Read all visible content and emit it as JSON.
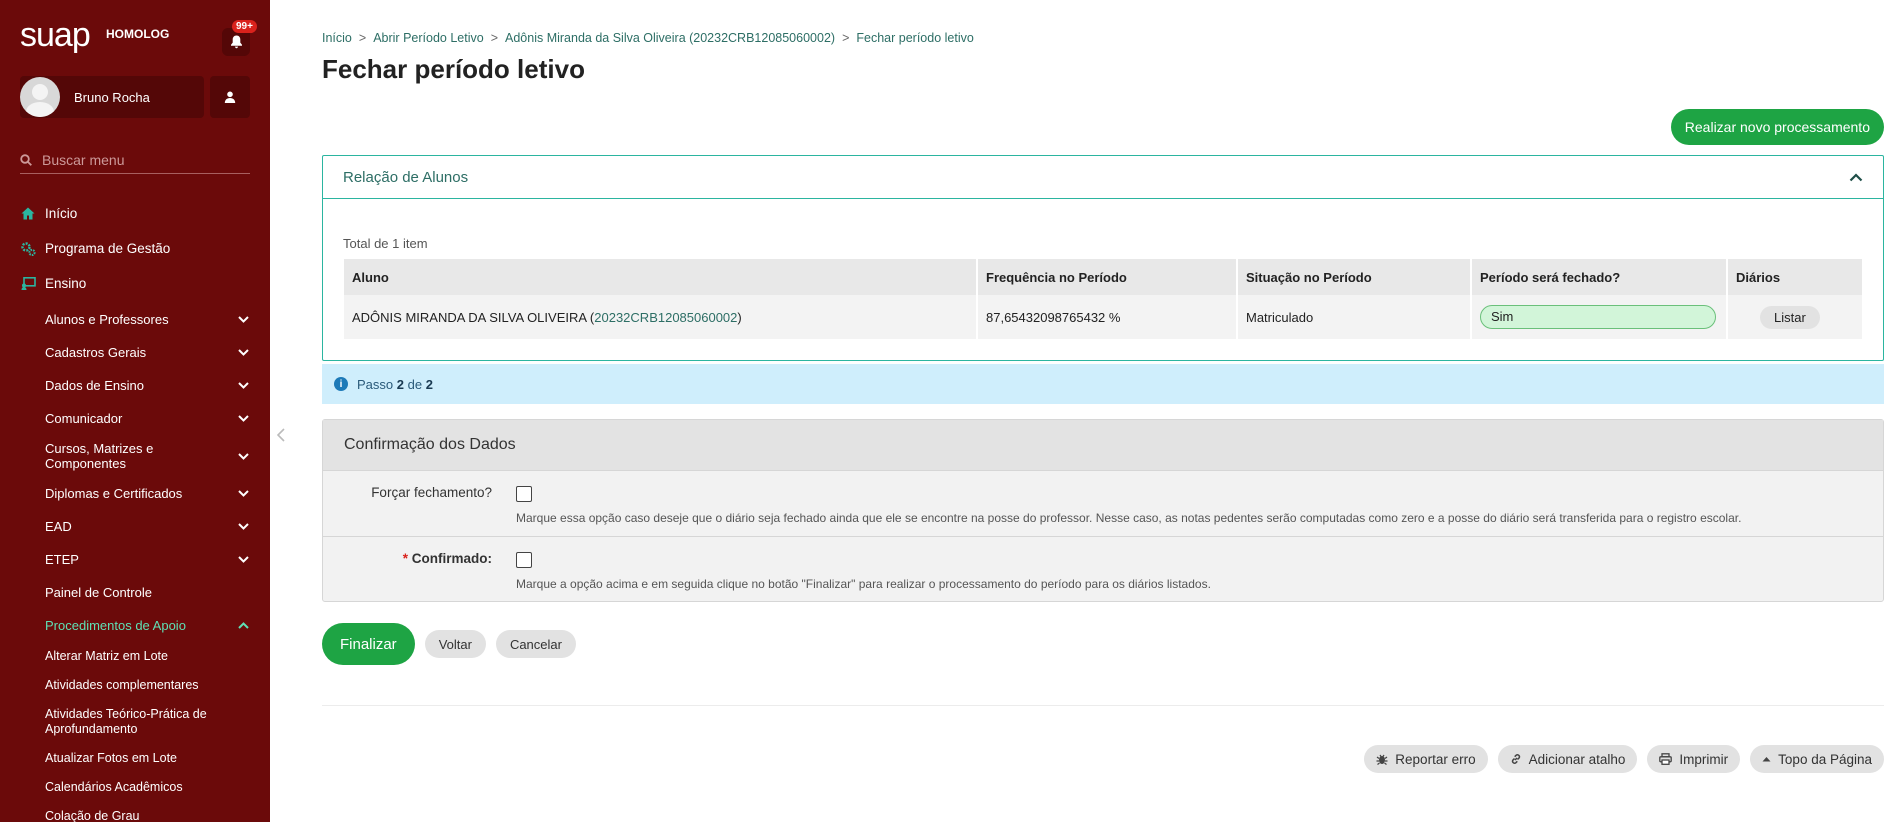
{
  "sidebar": {
    "logo": "suap",
    "environment": "HOMOLOG",
    "notifications_badge": "99+",
    "user_name": "Bruno Rocha",
    "search_placeholder": "Buscar menu",
    "top_items": [
      {
        "label": "Início",
        "icon": "home-icon"
      },
      {
        "label": "Programa de Gestão",
        "icon": "gears-icon"
      },
      {
        "label": "Ensino",
        "icon": "board-icon"
      }
    ],
    "ensino_items": [
      {
        "label": "Alunos e Professores",
        "expandable": true
      },
      {
        "label": "Cadastros Gerais",
        "expandable": true
      },
      {
        "label": "Dados de Ensino",
        "expandable": true
      },
      {
        "label": "Comunicador",
        "expandable": true
      },
      {
        "label": "Cursos, Matrizes e Componentes",
        "expandable": true
      },
      {
        "label": "Diplomas e Certificados",
        "expandable": true
      },
      {
        "label": "EAD",
        "expandable": true
      },
      {
        "label": "ETEP",
        "expandable": true
      },
      {
        "label": "Painel de Controle",
        "expandable": false
      },
      {
        "label": "Procedimentos de Apoio",
        "expandable": true,
        "active": true
      }
    ],
    "procedimentos_items": [
      "Alterar Matriz em Lote",
      "Atividades complementares",
      "Atividades Teórico-Prática de Aprofundamento",
      "Atualizar Fotos em Lote",
      "Calendários Acadêmicos",
      "Colação de Grau"
    ]
  },
  "breadcrumb": [
    "Início",
    "Abrir Período Letivo",
    "Adônis Miranda da Silva Oliveira (20232CRB12085060002)",
    "Fechar período letivo"
  ],
  "page_title": "Fechar período letivo",
  "new_processing_button": "Realizar novo processamento",
  "students_panel": {
    "title": "Relação de Alunos",
    "total": "Total de 1 item",
    "columns": [
      "Aluno",
      "Frequência no Período",
      "Situação no Período",
      "Período será fechado?",
      "Diários"
    ],
    "rows": [
      {
        "name_prefix": "ADÔNIS MIRANDA DA SILVA OLIVEIRA (",
        "matricula": "20232CRB12085060002",
        "name_suffix": ")",
        "frequencia": "87,65432098765432 %",
        "situacao": "Matriculado",
        "sera_fechado": "Sim",
        "diarios_button": "Listar"
      }
    ]
  },
  "step_info": {
    "prefix": "Passo",
    "current": "2",
    "middle": "de",
    "total": "2"
  },
  "confirmation": {
    "title": "Confirmação dos Dados",
    "force_label": "Forçar fechamento?",
    "force_help": "Marque essa opção caso deseje que o diário seja fechado ainda que ele se encontre na posse do professor. Nesse caso, as notas pedentes serão computadas como zero e a posse do diário será transferida para o registro escolar.",
    "confirmed_required": "*",
    "confirmed_label": "Confirmado:",
    "confirmed_help": "Marque a opção acima e em seguida clique no botão \"Finalizar\" para realizar o processamento do período para os diários listados."
  },
  "actions": {
    "finish": "Finalizar",
    "back": "Voltar",
    "cancel": "Cancelar"
  },
  "footer": {
    "report": "Reportar erro",
    "shortcut": "Adicionar atalho",
    "print": "Imprimir",
    "top": "Topo da Página"
  },
  "colors": {
    "sidebar_bg": "#6b0a0a",
    "primary_green": "#1ea444",
    "accent_teal": "#2bb5a0",
    "active_menu": "#5fe0b5"
  }
}
